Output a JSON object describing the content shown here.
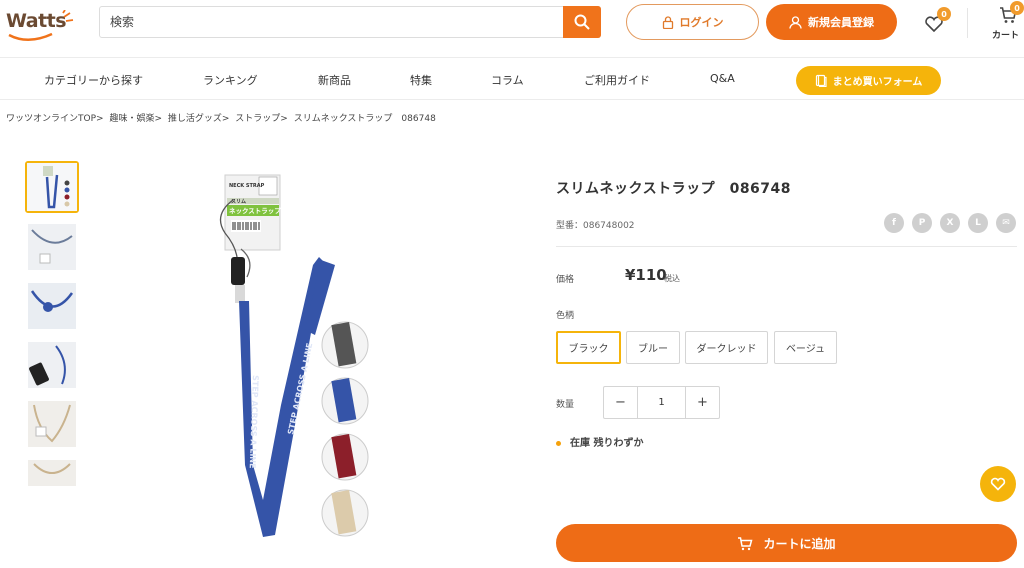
{
  "header": {
    "logo_text": "Watts",
    "search_placeholder": "検索",
    "login_label": "ログイン",
    "register_label": "新規会員登録",
    "favorites_count": "0",
    "cart_count": "0",
    "cart_label": "カート"
  },
  "nav": {
    "items": [
      "カテゴリーから探す",
      "ランキング",
      "新商品",
      "特集",
      "コラム",
      "ご利用ガイド",
      "Q&A"
    ],
    "bulk_order_label": "まとめ買いフォーム"
  },
  "breadcrumb": [
    "ワッツオンラインTOP>",
    "趣味・娯楽>",
    "推し活グッズ>",
    "ストラップ>",
    "スリムネックストラップ　086748"
  ],
  "product": {
    "title": "スリムネックストラップ　086748",
    "model": "型番：086748002",
    "price_label": "価格",
    "price": "¥110",
    "tax_label": "税込",
    "color_label": "色柄",
    "colors": [
      "ブラック",
      "ブルー",
      "ダークレッド",
      "ベージュ"
    ],
    "selected_color": "ブラック",
    "qty_label": "数量",
    "qty_value": "1",
    "qty_minus": "−",
    "qty_plus": "+",
    "stock_text": "在庫 残りわずか",
    "add_to_cart": "カートに追加",
    "package_text": [
      "NECK STRAP",
      "スリム",
      "ネックストラップ"
    ],
    "strap_text": "STEP ACROSS A LINE"
  },
  "share": [
    "f",
    "P",
    "X",
    "L",
    "✉"
  ],
  "colors": {
    "accent_orange": "#ee6c16",
    "accent_yellow": "#f5b40b",
    "strap_blue": "#3554a8"
  },
  "icons": [
    "search-icon",
    "lock-icon",
    "user-icon",
    "heart-icon",
    "cart-icon",
    "book-icon",
    "facebook-icon",
    "pinterest-icon",
    "x-icon",
    "line-icon",
    "mail-icon"
  ]
}
